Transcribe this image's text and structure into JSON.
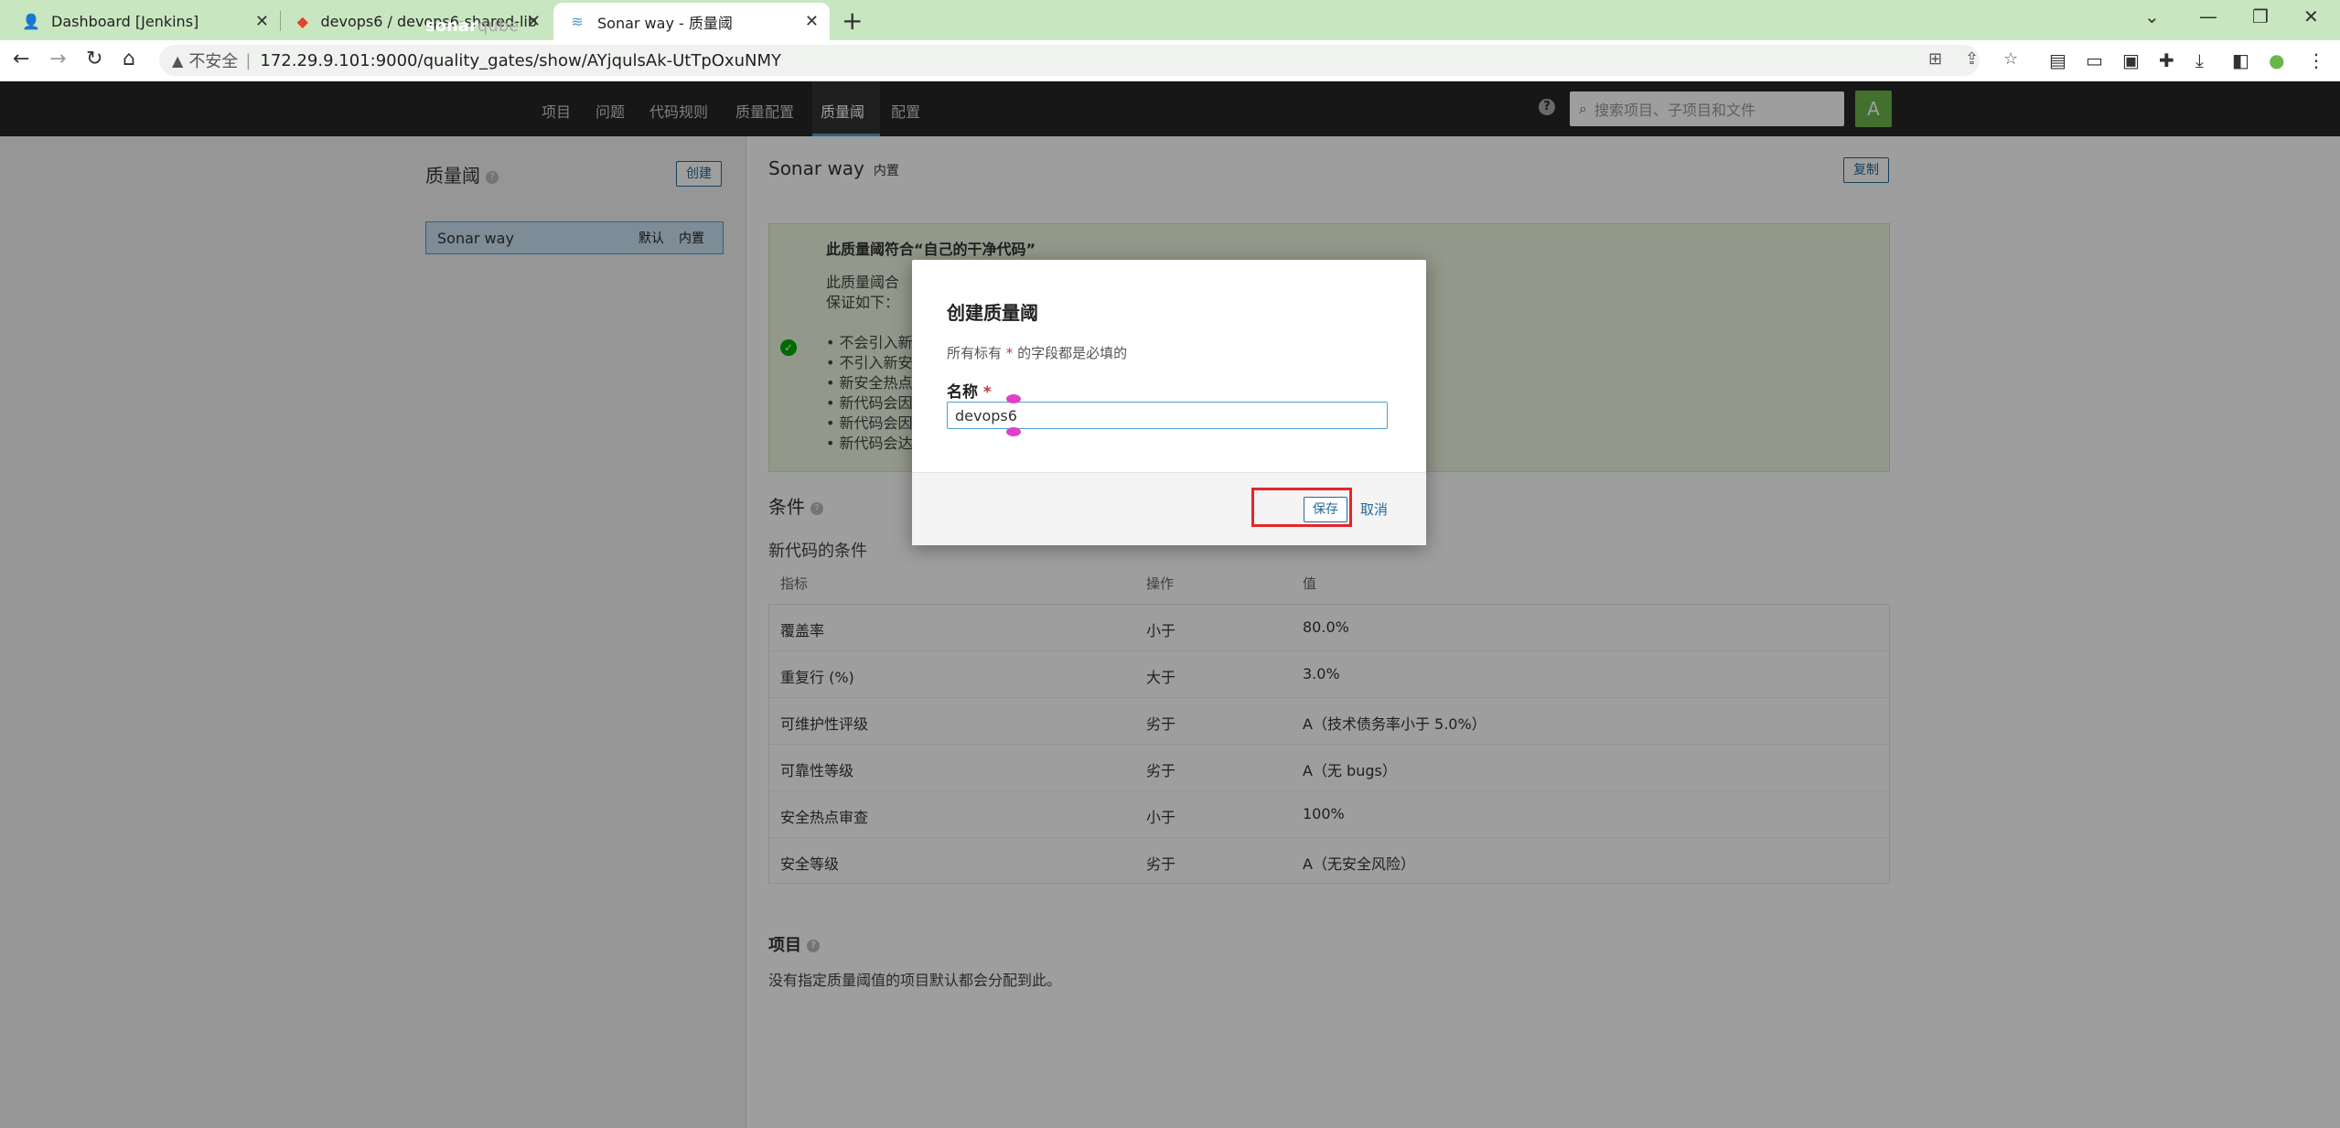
{
  "browser": {
    "tabs": [
      {
        "title": "Dashboard [Jenkins]",
        "icon": "jenkins-icon"
      },
      {
        "title": "devops6 / devops6-shared-lib",
        "icon": "gitlab-icon"
      },
      {
        "title": "Sonar way - 质量阈",
        "icon": "sonarqube-icon"
      }
    ],
    "address": {
      "insecure_label": "不安全",
      "url": "172.29.9.101:9000/quality_gates/show/AYjqulsAk-UtTpOxuNMY"
    }
  },
  "sonar": {
    "logo": {
      "main": "sonar",
      "suffix": "qube"
    },
    "menu": [
      "项目",
      "问题",
      "代码规则",
      "质量配置",
      "质量阈",
      "配置"
    ],
    "search_placeholder": "搜索项目、子项目和文件",
    "avatar_letter": "A"
  },
  "sidebar": {
    "title": "质量阈",
    "create_button": "创建",
    "gate": {
      "name": "Sonar way",
      "default_badge": "默认",
      "builtin_badge": "内置"
    }
  },
  "main": {
    "title": "Sonar way",
    "builtin_tag": "内置",
    "copy_button": "复制",
    "info": {
      "heading": "此质量阈符合“自己的干净代码”",
      "lines": [
        "此质量阈合",
        "保证如下：",
        "• 不会引入新",
        "• 不引入新安",
        "• 新安全热点",
        "• 新代码会因",
        "• 新代码会因",
        "• 新代码会达"
      ]
    },
    "conditions_title": "条件",
    "new_code_title": "新代码的条件",
    "table_headers": {
      "metric": "指标",
      "operator": "操作",
      "value": "值"
    },
    "conditions": [
      {
        "metric": "覆盖率",
        "operator": "小于",
        "value": "80.0%"
      },
      {
        "metric": "重复行 (%)",
        "operator": "大于",
        "value": "3.0%"
      },
      {
        "metric": "可维护性评级",
        "operator": "劣于",
        "value": "A（技术债务率小于 5.0%）"
      },
      {
        "metric": "可靠性等级",
        "operator": "劣于",
        "value": "A（无 bugs）"
      },
      {
        "metric": "安全热点审查",
        "operator": "小于",
        "value": "100%"
      },
      {
        "metric": "安全等级",
        "operator": "劣于",
        "value": "A（无安全风险）"
      }
    ],
    "projects_title": "项目",
    "projects_desc": "没有指定质量阈值的项目默认都会分配到此。"
  },
  "modal": {
    "title": "创建质量阈",
    "hint_prefix": "所有标有",
    "hint_star": "*",
    "hint_suffix": "的字段都是必填的",
    "name_label": "名称",
    "name_star": "*",
    "name_value": "devops6",
    "save_button": "保存",
    "cancel_link": "取消"
  },
  "colors": {
    "highlight_box": "#e8232a",
    "accent": "#4b9fd5",
    "link": "#236a97"
  }
}
